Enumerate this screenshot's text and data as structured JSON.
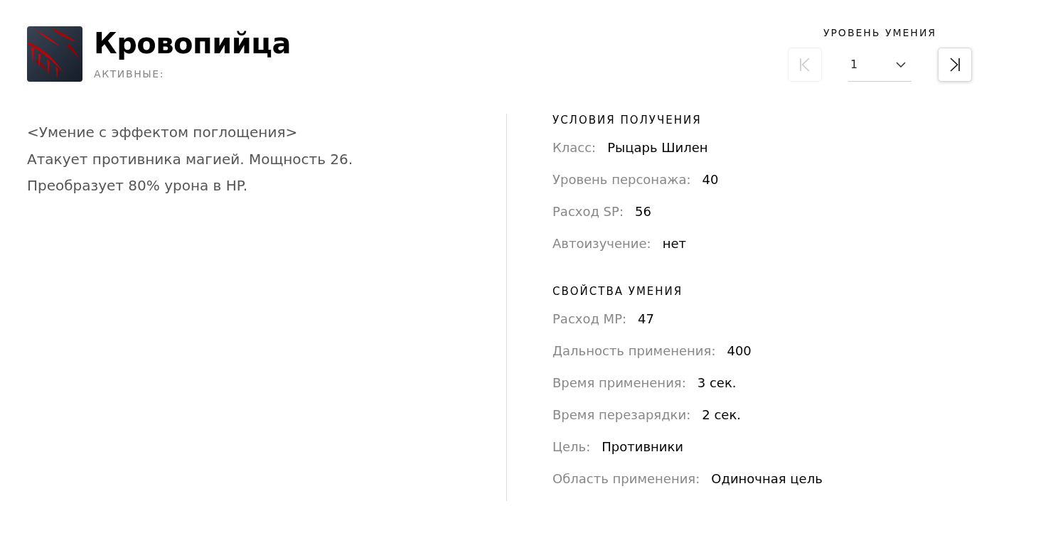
{
  "skill": {
    "title": "Кровопийца",
    "category": "АКТИВНЫЕ:"
  },
  "level_picker": {
    "label": "УРОВЕНЬ УМЕНИЯ",
    "first_button": {
      "disabled": true
    },
    "select": {
      "value": "1"
    },
    "last_button": {
      "disabled": false
    }
  },
  "description": [
    "<Умение с эффектом поглощения>",
    "Атакует противника магией. Мощность 26.",
    "Преобразует 80% урона в HP."
  ],
  "sections": [
    {
      "title": "УСЛОВИЯ ПОЛУЧЕНИЯ",
      "rows": [
        {
          "label": "Класс:",
          "value": "Рыцарь Шилен"
        },
        {
          "label": "Уровень персонажа:",
          "value": "40"
        },
        {
          "label": "Расход SP:",
          "value": "56"
        },
        {
          "label": "Автоизучение:",
          "value": "нет"
        }
      ]
    },
    {
      "title": "СВОЙСТВА УМЕНИЯ",
      "rows": [
        {
          "label": "Расход MP:",
          "value": "47"
        },
        {
          "label": "Дальность применения:",
          "value": "400"
        },
        {
          "label": "Время применения:",
          "value": "3 сек."
        },
        {
          "label": "Время перезарядки:",
          "value": "2 сек."
        },
        {
          "label": "Цель:",
          "value": "Противники"
        },
        {
          "label": "Область применения:",
          "value": "Одиночная цель"
        }
      ]
    }
  ]
}
